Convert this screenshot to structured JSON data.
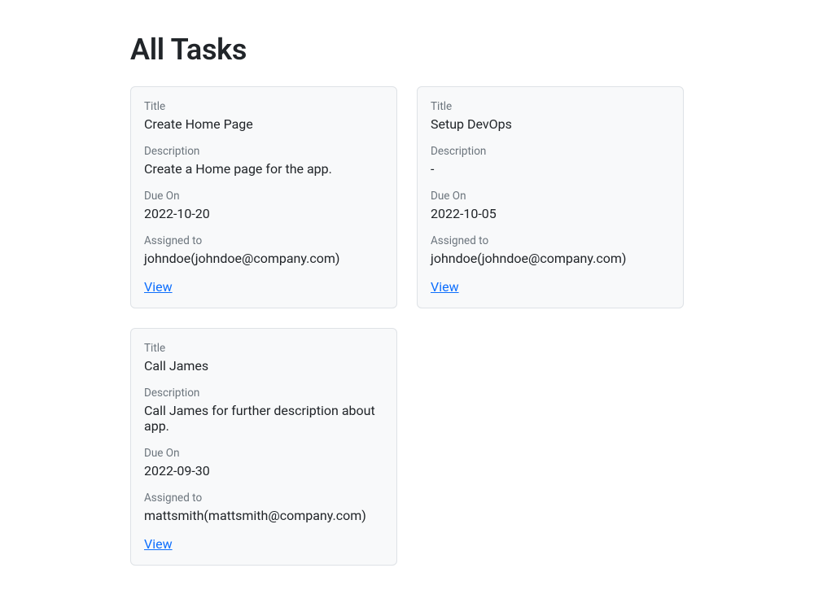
{
  "page_title": "All Tasks",
  "labels": {
    "title": "Title",
    "description": "Description",
    "due_on": "Due On",
    "assigned_to": "Assigned to",
    "view": "View"
  },
  "tasks": [
    {
      "title": "Create Home Page",
      "description": "Create a Home page for the app.",
      "due_on": "2022-10-20",
      "assigned_to": "johndoe(johndoe@company.com)"
    },
    {
      "title": "Setup DevOps",
      "description": "-",
      "due_on": "2022-10-05",
      "assigned_to": "johndoe(johndoe@company.com)"
    },
    {
      "title": "Call James",
      "description": "Call James for further description about app.",
      "due_on": "2022-09-30",
      "assigned_to": "mattsmith(mattsmith@company.com)"
    }
  ]
}
